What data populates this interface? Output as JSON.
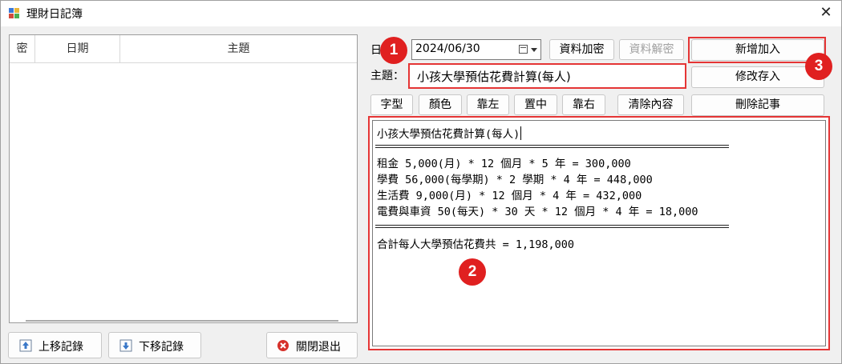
{
  "window": {
    "title": "理財日記簿",
    "close_glyph": "✕"
  },
  "grid": {
    "columns": [
      "密",
      "日期",
      "主題"
    ]
  },
  "labels": {
    "date": "日期",
    "subject": "主題："
  },
  "date_value": "2024/06/30",
  "subject_value": "小孩大學預估花費計算(每人)",
  "buttons": {
    "encrypt": "資料加密",
    "decrypt": "資料解密",
    "add": "新增加入",
    "modify_save": "修改存入",
    "delete": "刪除記事",
    "font": "字型",
    "color": "顏色",
    "align_left": "靠左",
    "align_center": "置中",
    "align_right": "靠右",
    "clear": "清除內容",
    "move_up": "上移記錄",
    "move_down": "下移記錄",
    "close_exit": "關閉退出"
  },
  "editor": {
    "title_line": "小孩大學預估花費計算(每人)",
    "items": [
      "租金 5,000(月) * 12 個月 * 5 年 = 300,000",
      "學費 56,000(每學期) * 2 學期 * 4 年 = 448,000",
      "生活費 9,000(月) * 12 個月 * 4 年 = 432,000",
      "電費與車資 50(每天) * 30 天 * 12 個月 * 4 年 = 18,000"
    ],
    "total": "合計每人大學預估花費共 = 1,198,000"
  },
  "badges": [
    "1",
    "2",
    "3"
  ],
  "colors": {
    "highlight": "#e53535",
    "badge": "#e02020"
  }
}
